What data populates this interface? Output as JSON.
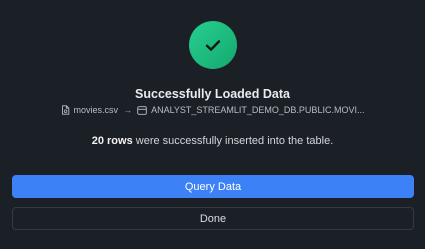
{
  "dialog": {
    "title": "Successfully Loaded Data",
    "source_file": "movies.csv",
    "arrow": "→",
    "destination": "ANALYST_STREAMLIT_DEMO_DB.PUBLIC.MOVI...",
    "message_count": "20 rows",
    "message_rest": " were successfully inserted into the table.",
    "primary_button_label": "Query Data",
    "secondary_button_label": "Done"
  },
  "colors": {
    "background": "#1b1f26",
    "success_green": "#1fbf80",
    "primary_blue": "#3c82f6"
  },
  "icons": {
    "status": "checkmark-icon",
    "file": "file-icon",
    "table": "table-icon"
  }
}
